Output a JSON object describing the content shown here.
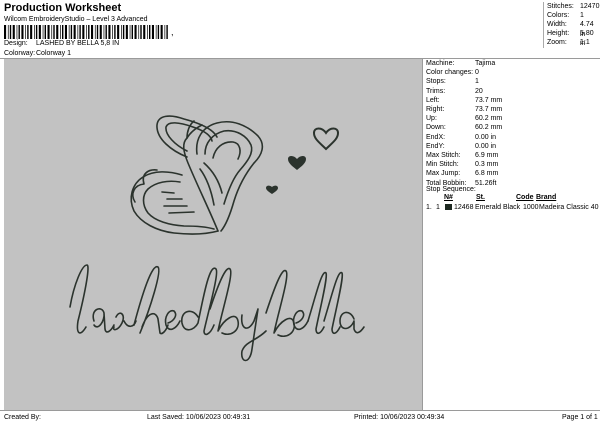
{
  "header": {
    "title": "Production Worksheet",
    "subtitle": "Wilcom EmbroideryStudio – Level 3 Advanced",
    "barcode_suffix": ","
  },
  "meta": {
    "design_label": "Design:",
    "design_value": "LASHED BY BELLA 5,8 IN",
    "colorway_label": "Colorway:",
    "colorway_value": "Colorway 1"
  },
  "summary": [
    {
      "label": "Stitches:",
      "value": "12470"
    },
    {
      "label": "Colors:",
      "value": "1"
    },
    {
      "label": "Width:",
      "value": "4.74 in"
    },
    {
      "label": "Height:",
      "value": "5.80 in"
    },
    {
      "label": "Zoom:",
      "value": "1:1"
    }
  ],
  "details": [
    {
      "label": "Machine:",
      "value": "Tajima"
    },
    {
      "label": "Color changes:",
      "value": "0"
    },
    {
      "label": "Stops:",
      "value": "1"
    },
    {
      "label": "Trims:",
      "value": "20"
    },
    {
      "label": "Left:",
      "value": "73.7 mm"
    },
    {
      "label": "Right:",
      "value": "73.7 mm"
    },
    {
      "label": "Up:",
      "value": "60.2 mm"
    },
    {
      "label": "Down:",
      "value": "60.2 mm"
    },
    {
      "label": "EndX:",
      "value": "0.00 in"
    },
    {
      "label": "EndY:",
      "value": "0.00 in"
    },
    {
      "label": "Max Stitch:",
      "value": "6.9 mm"
    },
    {
      "label": "Min Stitch:",
      "value": "0.3 mm"
    },
    {
      "label": "Max Jump:",
      "value": "6.8 mm"
    },
    {
      "label": "Total Bobbin:",
      "value": "51.26ft"
    }
  ],
  "stop_sequence": {
    "title": "Stop Sequence:",
    "headers": {
      "n": "N#",
      "st": "St.",
      "code": "Code",
      "brand": "Brand"
    },
    "rows": [
      {
        "idx": "1.",
        "n": "1",
        "swatch": "#1f2a22",
        "st": "12468",
        "name": "Emerald Black",
        "code": "1000",
        "brand": "Madeira Classic 40"
      }
    ]
  },
  "design_text": "lashed by bella",
  "colors": {
    "design_bg": "#c2c2c2",
    "thread": "#2b332d"
  },
  "footer": {
    "created": "Created By:",
    "saved": "Last Saved: 10/06/2023 00:49:31",
    "printed": "Printed: 10/06/2023 00:49:34",
    "page": "Page 1 of 1"
  }
}
